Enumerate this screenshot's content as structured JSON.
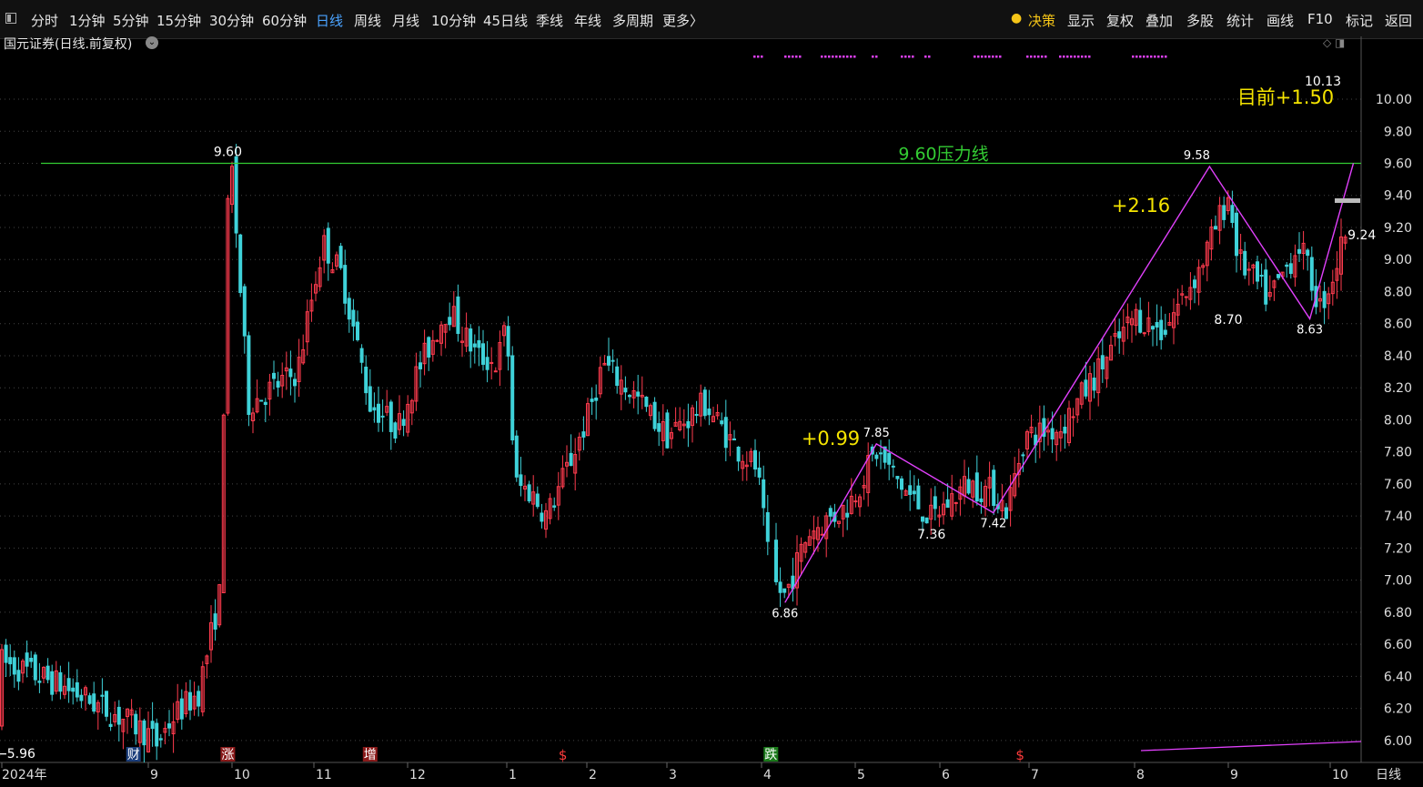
{
  "toolbar": {
    "periods": [
      "分时",
      "1分钟",
      "5分钟",
      "15分钟",
      "30分钟",
      "60分钟",
      "日线",
      "周线",
      "月线",
      "10分钟",
      "45日线",
      "季线",
      "年线",
      "多周期",
      "更多〉"
    ],
    "active_period": "日线",
    "right_items": [
      "决策",
      "显示",
      "复权",
      "叠加",
      "多股",
      "统计",
      "画线",
      "F10",
      "标记",
      "返回"
    ]
  },
  "chart_title": "国元证券(日线.前复权)",
  "colors": {
    "up": "#ff3b4e",
    "down": "#3fd2d9",
    "resistance": "#33cc33",
    "zigzag": "#e040fb",
    "annot": "#f5e400",
    "grid": "#444"
  },
  "chart_data": {
    "type": "candlestick",
    "ylim": [
      5.88,
      10.42
    ],
    "y_ticks": [
      "10.00",
      "9.80",
      "9.60",
      "9.40",
      "9.20",
      "9.00",
      "8.80",
      "8.60",
      "8.40",
      "8.20",
      "8.00",
      "7.80",
      "7.60",
      "7.40",
      "7.20",
      "7.00",
      "6.80",
      "6.60",
      "6.40",
      "6.20",
      "6.00"
    ],
    "x_labels": [
      "2024年",
      "9",
      "10",
      "11",
      "12",
      "1",
      "2",
      "3",
      "4",
      "5",
      "6",
      "7",
      "8",
      "9",
      "10"
    ],
    "period_label": "日线",
    "resistance": {
      "value": 9.6,
      "label": "9.60压力线"
    },
    "zigzag": [
      {
        "month": 4.25,
        "value": 6.86,
        "label": "6.86"
      },
      {
        "month": 5.25,
        "value": 7.85,
        "label": "7.85"
      },
      {
        "month": 6.6,
        "value": 7.42,
        "label": "7.42"
      },
      {
        "month": 8.8,
        "value": 9.58,
        "label": "9.58"
      },
      {
        "month": 9.8,
        "value": 8.63,
        "label": "8.63"
      },
      {
        "month": 10.3,
        "value": 9.6,
        "label": ""
      }
    ],
    "price_labels": [
      {
        "month": 7.9,
        "value": 5.96,
        "label": "5.96"
      },
      {
        "month": 9.95,
        "value": 9.6,
        "label": "9.60"
      },
      {
        "month": 5.9,
        "value": 7.36,
        "label": "7.36"
      },
      {
        "month": 9.0,
        "value": 8.7,
        "label": "8.70"
      },
      {
        "month": 10.2,
        "value": 10.13,
        "label": "10.13"
      },
      {
        "month": 10.35,
        "value": 9.24,
        "label": "9.24"
      }
    ],
    "annotations": [
      "+0.99",
      "+2.16",
      "目前+1.50"
    ],
    "event_markers": [
      {
        "label": "涨",
        "month": 9.95
      },
      {
        "label": "增",
        "month": 11.6
      },
      {
        "label": "$",
        "month": 1.7
      },
      {
        "label": "跌",
        "month": 4.1
      },
      {
        "label": "$",
        "month": 6.9
      },
      {
        "label": "财",
        "month": 8.9
      }
    ]
  }
}
